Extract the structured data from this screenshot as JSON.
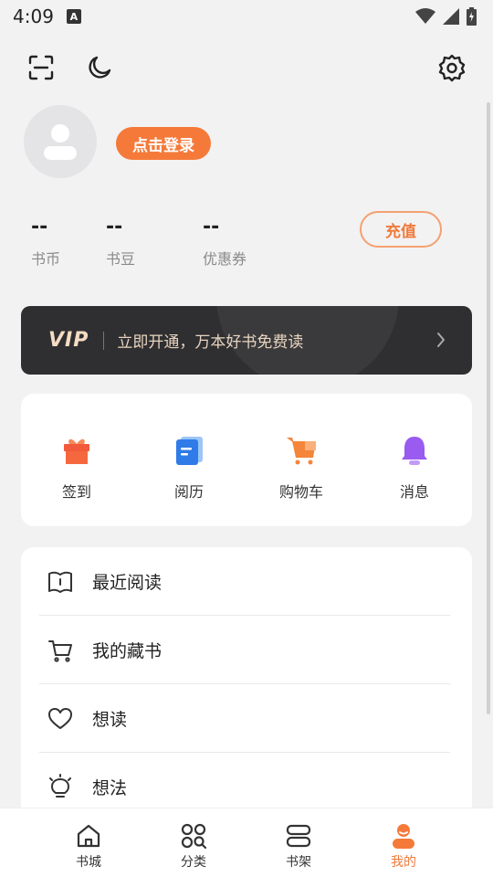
{
  "status_bar": {
    "time": "4:09",
    "badge": "A"
  },
  "top_icons": [
    "scan-icon",
    "moon-icon",
    "gear-icon"
  ],
  "profile": {
    "login_label": "点击登录"
  },
  "stats": [
    {
      "value": "--",
      "label": "书币"
    },
    {
      "value": "--",
      "label": "书豆"
    },
    {
      "value": "--",
      "label": "优惠券"
    }
  ],
  "recharge_label": "充值",
  "vip": {
    "logo": "VIP",
    "text": "立即开通，万本好书免费读"
  },
  "quick_actions": [
    {
      "label": "签到",
      "icon": "gift-icon"
    },
    {
      "label": "阅历",
      "icon": "history-icon"
    },
    {
      "label": "购物车",
      "icon": "cart-icon"
    },
    {
      "label": "消息",
      "icon": "bell-icon"
    }
  ],
  "menu": [
    {
      "label": "最近阅读",
      "icon": "book-icon"
    },
    {
      "label": "我的藏书",
      "icon": "cart-outline-icon"
    },
    {
      "label": "想读",
      "icon": "heart-icon"
    },
    {
      "label": "想法",
      "icon": "bulb-icon"
    }
  ],
  "tabs": [
    {
      "label": "书城",
      "icon": "home-icon"
    },
    {
      "label": "分类",
      "icon": "category-icon"
    },
    {
      "label": "书架",
      "icon": "shelf-icon"
    },
    {
      "label": "我的",
      "icon": "profile-icon",
      "active": true
    }
  ],
  "colors": {
    "accent": "#f57a3a",
    "vip_bg": "#2f2f31",
    "page_bg": "#f2f2f2"
  }
}
